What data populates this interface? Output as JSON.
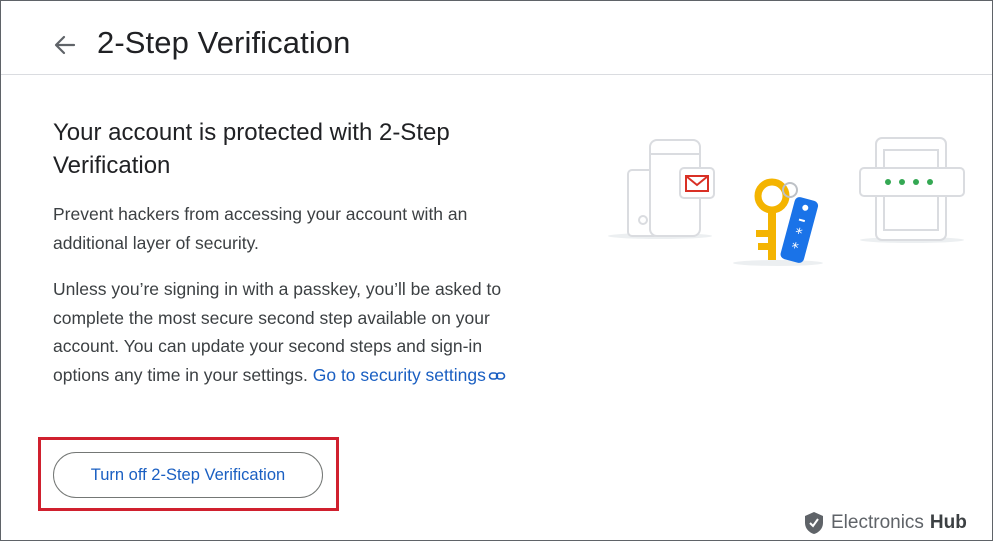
{
  "header": {
    "title": "2-Step Verification",
    "back_icon": "arrow-back-icon"
  },
  "main": {
    "heading": "Your account is protected with 2-Step Verification",
    "description": "Prevent hackers from accessing your account with an additional layer of security.",
    "info_text": "Unless you’re signing in with a passkey, you’ll be asked to complete the most secure second step available on your account. You can update your second steps and sign-in options any time in your settings.",
    "security_link": "Go to security settings",
    "turn_off_button": "Turn off 2-Step Verification"
  },
  "watermark": {
    "brand_light": "Electronics",
    "brand_bold": "Hub"
  },
  "colors": {
    "link": "#1a5fc2",
    "highlight": "#d0202e",
    "key": "#f4b400",
    "tag": "#1a73e8",
    "dots": "#34a853",
    "mail": "#d93025"
  }
}
